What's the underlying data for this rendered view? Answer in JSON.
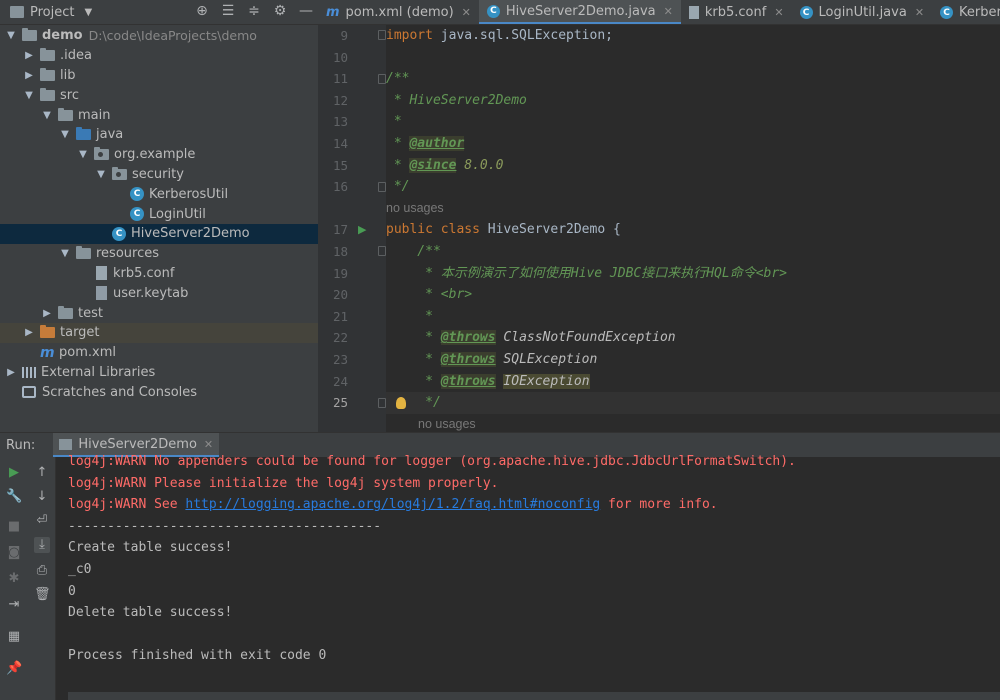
{
  "project": {
    "title": "Project",
    "tree": [
      {
        "label": "demo",
        "sub": "D:\\code\\IdeaProjects\\demo"
      },
      {
        "label": ".idea"
      },
      {
        "label": "lib"
      },
      {
        "label": "src"
      },
      {
        "label": "main"
      },
      {
        "label": "java"
      },
      {
        "label": "org.example"
      },
      {
        "label": "security"
      },
      {
        "label": "KerberosUtil"
      },
      {
        "label": "LoginUtil"
      },
      {
        "label": "HiveServer2Demo"
      },
      {
        "label": "resources"
      },
      {
        "label": "krb5.conf"
      },
      {
        "label": "user.keytab"
      },
      {
        "label": "test"
      },
      {
        "label": "target"
      },
      {
        "label": "pom.xml"
      },
      {
        "label": "External Libraries"
      },
      {
        "label": "Scratches and Consoles"
      }
    ]
  },
  "editor": {
    "tabs": [
      {
        "label": "pom.xml (demo)",
        "icon": "maven-icon"
      },
      {
        "label": "HiveServer2Demo.java",
        "icon": "class-icon",
        "active": true
      },
      {
        "label": "krb5.conf",
        "icon": "file-icon"
      },
      {
        "label": "LoginUtil.java",
        "icon": "class-icon"
      },
      {
        "label": "KerberosUtil.java",
        "icon": "class-icon"
      }
    ],
    "line_numbers": [
      "9",
      "10",
      "11",
      "12",
      "13",
      "14",
      "15",
      "16",
      "",
      "17",
      "18",
      "19",
      "20",
      "21",
      "22",
      "23",
      "24",
      "25"
    ],
    "code": {
      "l9_kw": "import",
      "l9_rest": " java.sql.SQLException;",
      "l11": "/**",
      "l12": " * HiveServer2Demo",
      "l13": " *",
      "l14_pre": " * ",
      "l14_tag": "@author",
      "l15_pre": " * ",
      "l15_tag": "@since",
      "l15_val": " 8.0.0",
      "l16": " */",
      "usage1": "no usages",
      "l17_kw": "public class",
      "l17_rest": " HiveServer2Demo {",
      "l18": "    /**",
      "l19": "     * 本示例演示了如何使用Hive JDBC接口来执行HQL命令<br>",
      "l20": "     * <br>",
      "l21": "     *",
      "l22_pre": "     * ",
      "l22_tag": "@throws",
      "l22_val": " ClassNotFoundException",
      "l23_pre": "     * ",
      "l23_tag": "@throws",
      "l23_val": " SQLException",
      "l24_pre": "     * ",
      "l24_tag": "@throws",
      "l24_val": "IOException",
      "l25": "     */",
      "usage2": "no usages"
    }
  },
  "run": {
    "label": "Run:",
    "tab": "HiveServer2Demo",
    "output": {
      "w1": "log4j:WARN No appenders could be found for logger (org.apache.hive.jdbc.JdbcUrlFormatSwitch).",
      "w2": "log4j:WARN Please initialize the log4j system properly.",
      "w3_pre": "log4j:WARN See ",
      "w3_link": "http://logging.apache.org/log4j/1.2/faq.html#noconfig",
      "w3_post": " for more info.",
      "sep": "----------------------------------------",
      "o1": "Create table success!",
      "o2": "_c0",
      "o3": "0",
      "o4": "Delete table success!",
      "o5": "Process finished with exit code 0"
    }
  }
}
